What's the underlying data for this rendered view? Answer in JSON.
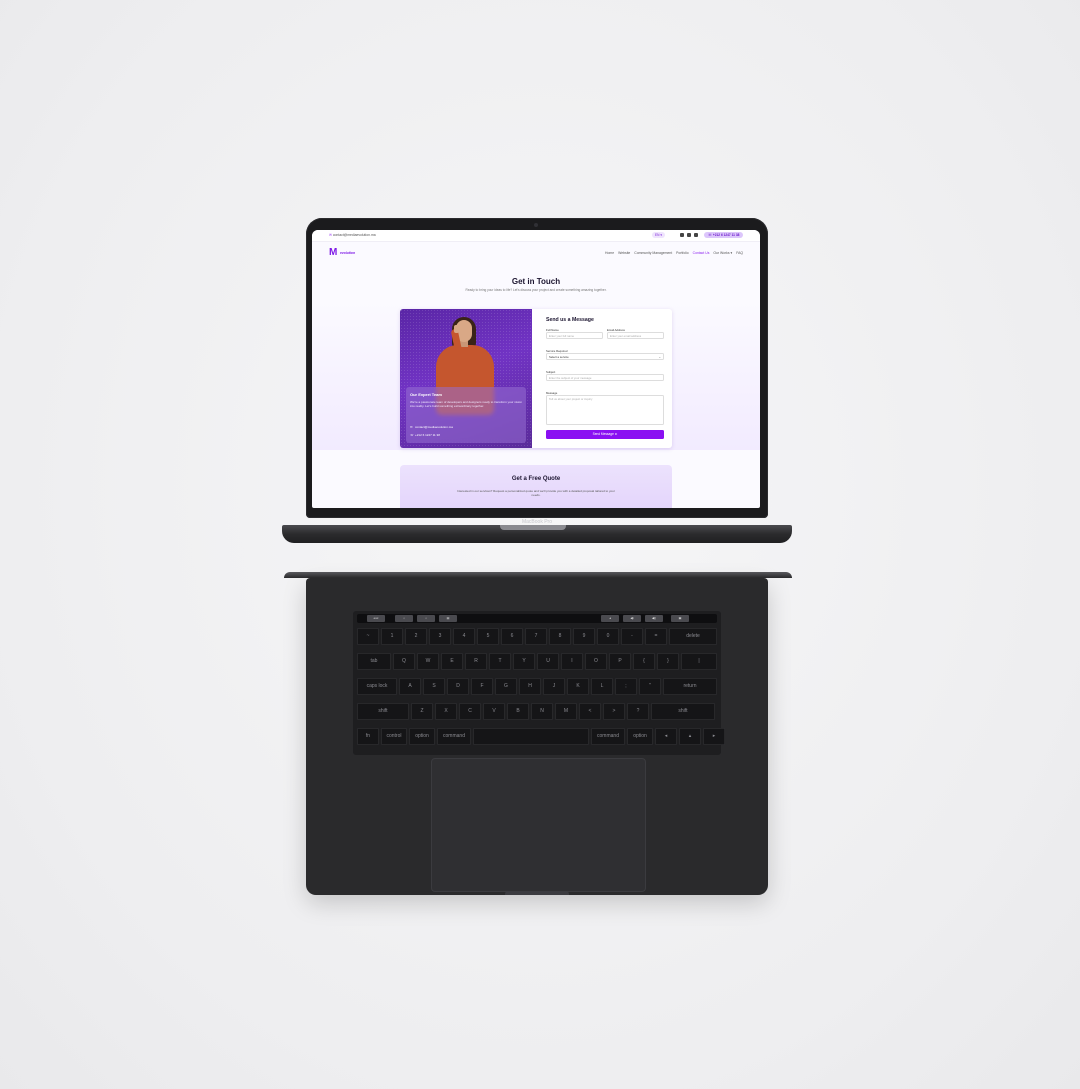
{
  "device": {
    "brand_label": "MacBook Pro"
  },
  "topbar": {
    "email": "contact@mediaevolution.ma",
    "language": "EN ▾",
    "phone": "+212 6 1247 11 38"
  },
  "nav": {
    "logo_mark": "M",
    "logo_text": "evolution",
    "links": [
      "Home",
      "Website",
      "Community Management",
      "Portfolio",
      "Contact Us",
      "Our Works ▾",
      "FAQ"
    ],
    "active": "Contact Us"
  },
  "hero": {
    "title": "Get in Touch",
    "subtitle": "Ready to bring your ideas to life? Let's discuss your project and create something amazing together."
  },
  "team_card": {
    "title": "Our Expert Team",
    "description": "We're a passionate team of developers and designers ready to transform your vision into reality. Let's build something extraordinary together.",
    "email": "contact@mediaevolution.ma",
    "phone": "+212 6 1247 11 38"
  },
  "form": {
    "title": "Send us a Message",
    "full_name_label": "Full Name",
    "full_name_placeholder": "Enter your full name",
    "email_label": "Email Address",
    "email_placeholder": "Enter your email address",
    "service_label": "Service Required",
    "service_value": "Select a service",
    "subject_label": "Subject",
    "subject_placeholder": "Enter the subject of your message",
    "message_label": "Message",
    "message_placeholder": "Tell us about your project or inquiry",
    "send_label": "Send Message ➤"
  },
  "quote": {
    "title": "Get a Free Quote",
    "subtitle": "Interested in our services? Request a personalized quote and we'll provide you with a detailed proposal tailored to your needs."
  },
  "keyboard": {
    "touchbar_keys": [
      "esc",
      "☼",
      "☼",
      "▤",
      "◂",
      "◀)",
      "◀))",
      "▣"
    ],
    "rows": [
      [
        "~",
        "1",
        "2",
        "3",
        "4",
        "5",
        "6",
        "7",
        "8",
        "9",
        "0",
        "-",
        "=",
        "delete"
      ],
      [
        "tab",
        "Q",
        "W",
        "E",
        "R",
        "T",
        "Y",
        "U",
        "I",
        "O",
        "P",
        "{",
        "}",
        "|"
      ],
      [
        "caps lock",
        "A",
        "S",
        "D",
        "F",
        "G",
        "H",
        "J",
        "K",
        "L",
        ";",
        "\"",
        "return"
      ],
      [
        "shift",
        "Z",
        "X",
        "C",
        "V",
        "B",
        "N",
        "M",
        "<",
        ">",
        "?",
        "shift"
      ],
      [
        "fn",
        "control",
        "option",
        "command",
        "",
        "command",
        "option",
        "◂",
        "▴",
        "▸"
      ]
    ]
  }
}
